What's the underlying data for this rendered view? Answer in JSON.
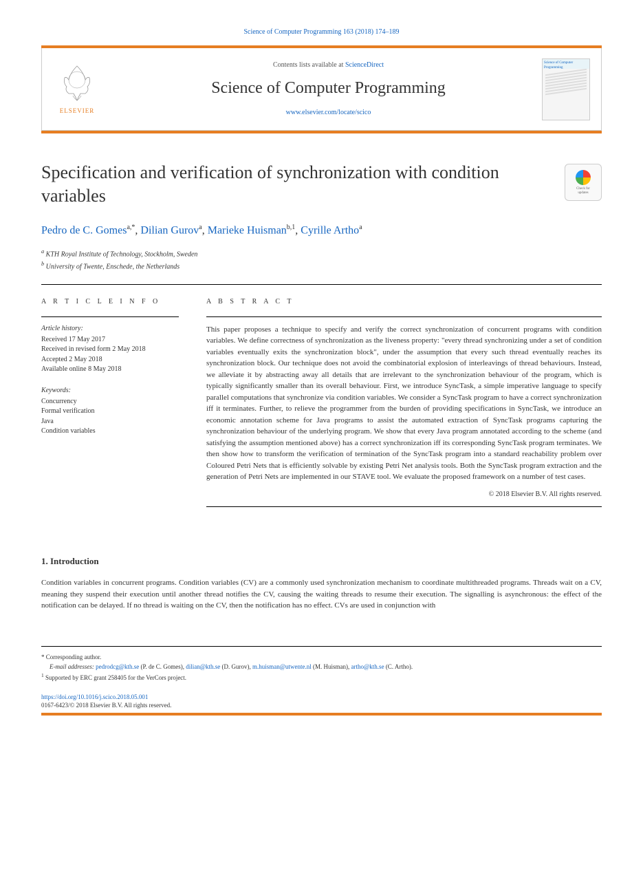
{
  "citation": "Science of Computer Programming 163 (2018) 174–189",
  "header": {
    "contents_text": "Contents lists available at ",
    "contents_link": "ScienceDirect",
    "journal_name": "Science of Computer Programming",
    "journal_url": "www.elsevier.com/locate/scico",
    "publisher": "ELSEVIER",
    "cover_label": "Science of Computer Programming"
  },
  "crossmark": {
    "line1": "Check for",
    "line2": "updates"
  },
  "title": "Specification and verification of synchronization with condition variables",
  "authors": [
    {
      "name": "Pedro de C. Gomes",
      "affil": "a,",
      "mark": "*"
    },
    {
      "name": "Dilian Gurov",
      "affil": "a",
      "mark": ""
    },
    {
      "name": "Marieke Huisman",
      "affil": "b,1",
      "mark": ""
    },
    {
      "name": "Cyrille Artho",
      "affil": "a",
      "mark": ""
    }
  ],
  "affiliations": {
    "a": "KTH Royal Institute of Technology, Stockholm, Sweden",
    "b": "University of Twente, Enschede, the Netherlands"
  },
  "article_info": {
    "heading": "A R T I C L E   I N F O",
    "history_label": "Article history:",
    "history": "Received 17 May 2017\nReceived in revised form 2 May 2018\nAccepted 2 May 2018\nAvailable online 8 May 2018",
    "keywords_label": "Keywords:",
    "keywords": "Concurrency\nFormal verification\nJava\nCondition variables"
  },
  "abstract": {
    "heading": "A B S T R A C T",
    "text": "This paper proposes a technique to specify and verify the correct synchronization of concurrent programs with condition variables. We define correctness of synchronization as the liveness property: \"every thread synchronizing under a set of condition variables eventually exits the synchronization block\", under the assumption that every such thread eventually reaches its synchronization block. Our technique does not avoid the combinatorial explosion of interleavings of thread behaviours. Instead, we alleviate it by abstracting away all details that are irrelevant to the synchronization behaviour of the program, which is typically significantly smaller than its overall behaviour. First, we introduce SyncTask, a simple imperative language to specify parallel computations that synchronize via condition variables. We consider a SyncTask program to have a correct synchronization iff it terminates. Further, to relieve the programmer from the burden of providing specifications in SyncTask, we introduce an economic annotation scheme for Java programs to assist the automated extraction of SyncTask programs capturing the synchronization behaviour of the underlying program. We show that every Java program annotated according to the scheme (and satisfying the assumption mentioned above) has a correct synchronization iff its corresponding SyncTask program terminates. We then show how to transform the verification of termination of the SyncTask program into a standard reachability problem over Coloured Petri Nets that is efficiently solvable by existing Petri Net analysis tools. Both the SyncTask program extraction and the generation of Petri Nets are implemented in our STAVE tool. We evaluate the proposed framework on a number of test cases.",
    "copyright": "© 2018 Elsevier B.V. All rights reserved."
  },
  "section1": {
    "heading": "1. Introduction",
    "para1": "Condition variables in concurrent programs. Condition variables (CV) are a commonly used synchronization mechanism to coordinate multithreaded programs. Threads wait on a CV, meaning they suspend their execution until another thread notifies the CV, causing the waiting threads to resume their execution. The signalling is asynchronous: the effect of the notification can be delayed. If no thread is waiting on the CV, then the notification has no effect. CVs are used in conjunction with"
  },
  "footnotes": {
    "corresponding": "Corresponding author.",
    "emails_label": "E-mail addresses:",
    "emails": [
      {
        "addr": "pedrodcg@kth.se",
        "name": "(P. de C. Gomes)"
      },
      {
        "addr": "dilian@kth.se",
        "name": "(D. Gurov)"
      },
      {
        "addr": "m.huisman@utwente.nl",
        "name": "(M. Huisman)"
      },
      {
        "addr": "artho@kth.se",
        "name": "(C. Artho)"
      }
    ],
    "note1": "Supported by ERC grant 258405 for the VerCors project."
  },
  "doi": {
    "url": "https://doi.org/10.1016/j.scico.2018.05.001",
    "issn_line": "0167-6423/© 2018 Elsevier B.V. All rights reserved."
  }
}
